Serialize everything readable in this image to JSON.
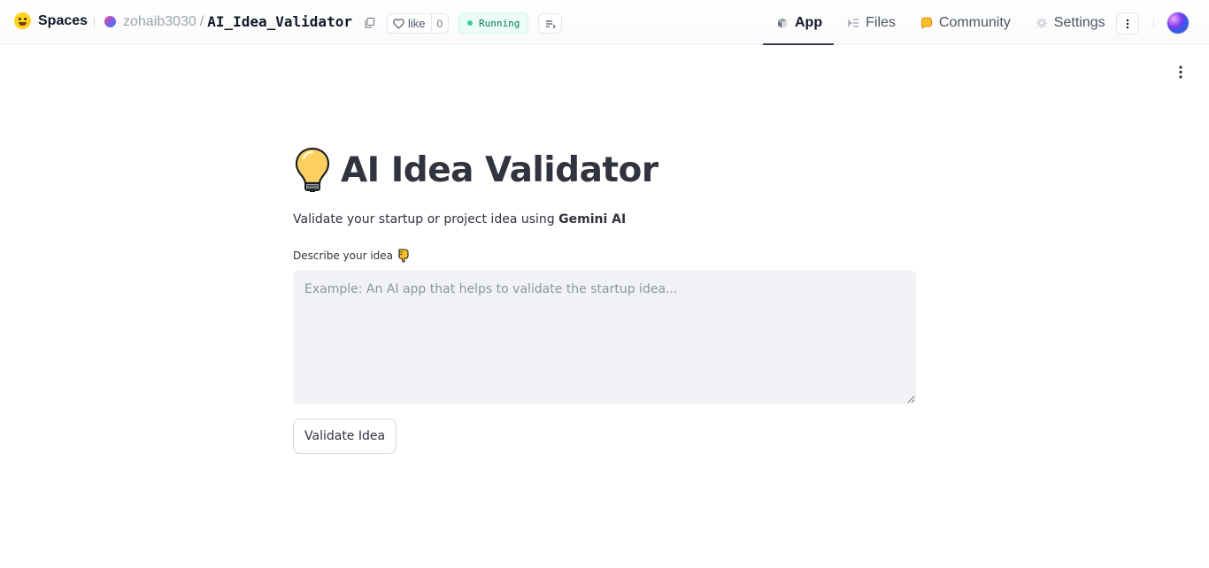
{
  "header": {
    "brand_label": "Spaces",
    "owner": "zohaib3030",
    "separator": "/",
    "repo_name": "AI_Idea_Validator",
    "like_label": "like",
    "like_count": "0",
    "status": "Running",
    "status_color": "#047857",
    "tabs": [
      {
        "label": "App",
        "icon": "cube-icon",
        "active": true
      },
      {
        "label": "Files",
        "icon": "files-icon",
        "active": false
      },
      {
        "label": "Community",
        "icon": "community-icon",
        "active": false
      },
      {
        "label": "Settings",
        "icon": "gear-icon",
        "active": false
      }
    ]
  },
  "app": {
    "title": "AI Idea Validator",
    "title_icon": "lightbulb-icon",
    "subtitle_prefix": "Validate your startup or project idea using ",
    "subtitle_bold": "Gemini AI",
    "field_label": "Describe your idea",
    "field_label_icon": "pointing-down-icon",
    "textarea_placeholder": "Example: An AI app that helps to validate the startup idea...",
    "textarea_value": "",
    "button_label": "Validate Idea"
  },
  "colors": {
    "text": "#31333f",
    "textarea_bg": "#f0f2f6",
    "status_bg": "#ecfdf5"
  }
}
